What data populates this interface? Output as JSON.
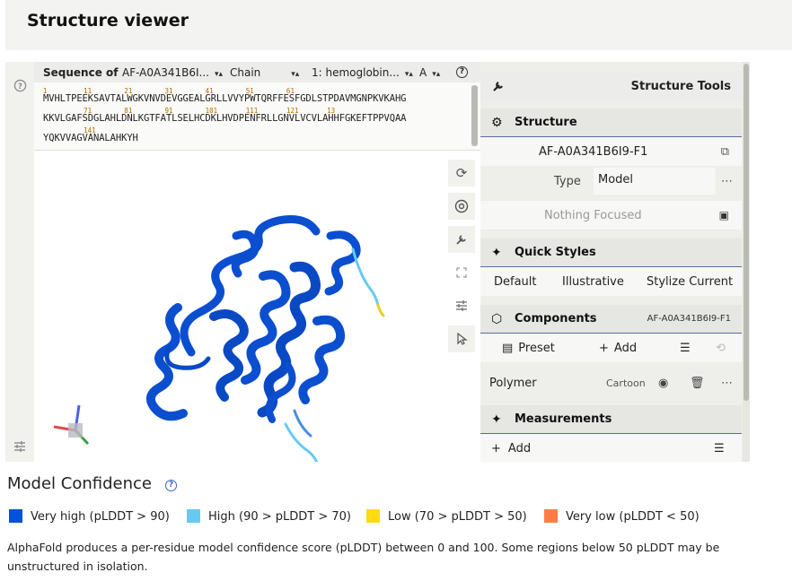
{
  "header": {
    "title": "Structure viewer"
  },
  "sequence": {
    "label": "Sequence of",
    "entry": "AF-A0A341B6I...",
    "mode": "Chain",
    "chain": "1: hemoglobin...",
    "letter": "A",
    "lines": [
      {
        "nums": "1         11        21        31        41        51        61",
        "res": "MVHLTPEEKSAVTALWGKVNVDEVGGEALGRLLVVYPWTQRFFESFGDLSTPDAVMGNPKVKAHG"
      },
      {
        "nums": "          71        81        91        101       111       121       13",
        "res": "KKVLGAFSDGLAHLDNLKGTFATLSELHCDKLHVDPENFRLLGNVLVCVLAHHFGKEFTPPVQAA"
      },
      {
        "nums": "          141",
        "res": "YQKVVAGVANALAHKYH"
      }
    ]
  },
  "canvas_tools": [
    "reset-icon",
    "screenshot-icon",
    "wrench-icon",
    "expand-icon",
    "sliders-icon",
    "cursor-icon"
  ],
  "tools": {
    "title": "Structure Tools",
    "structure": {
      "title": "Structure",
      "id": "AF-A0A341B6I9-F1",
      "type_label": "Type",
      "type_value": "Model",
      "focus": "Nothing Focused"
    },
    "quick_styles": {
      "title": "Quick Styles",
      "options": [
        "Default",
        "Illustrative",
        "Stylize Current"
      ]
    },
    "components": {
      "title": "Components",
      "id": "AF-A0A341B6I9-F1",
      "preset": "Preset",
      "add": "Add",
      "polymer": "Polymer",
      "repr": "Cartoon"
    },
    "measurements": {
      "title": "Measurements",
      "add": "Add"
    }
  },
  "confidence": {
    "title": "Model Confidence",
    "legend": [
      {
        "label": "Very high (pLDDT > 90)",
        "color": "#0053d6"
      },
      {
        "label": "High (90 > pLDDT > 70)",
        "color": "#65cbf3"
      },
      {
        "label": "Low (70 > pLDDT > 50)",
        "color": "#ffdb13"
      },
      {
        "label": "Very low (pLDDT < 50)",
        "color": "#ff7d45"
      }
    ],
    "description": "AlphaFold produces a per-residue model confidence score (pLDDT) between 0 and 100. Some regions below 50 pLDDT may be unstructured in isolation."
  }
}
